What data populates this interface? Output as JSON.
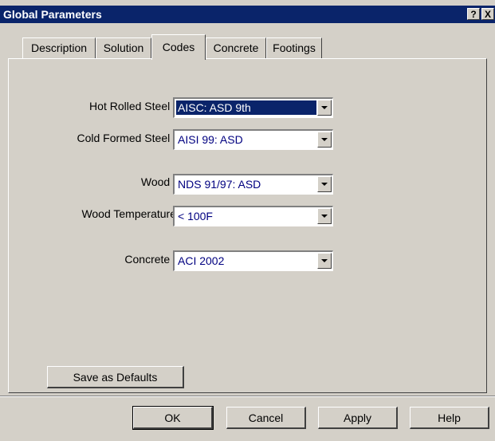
{
  "window": {
    "title": "Global Parameters",
    "help_button": "?",
    "close_button": "X"
  },
  "tabs": [
    {
      "label": "Description"
    },
    {
      "label": "Solution"
    },
    {
      "label": "Codes",
      "active": true
    },
    {
      "label": "Concrete"
    },
    {
      "label": "Footings"
    }
  ],
  "codes": {
    "hot_rolled_steel": {
      "label": "Hot Rolled Steel :",
      "value": "AISC: ASD 9th"
    },
    "cold_formed_steel": {
      "label": "Cold Formed Steel :",
      "value": "AISI 99: ASD"
    },
    "wood": {
      "label": "Wood :",
      "value": "NDS 91/97: ASD"
    },
    "wood_temperature": {
      "label": "Wood Temperature",
      "value": "< 100F"
    },
    "concrete": {
      "label": "Concrete :",
      "value": "ACI 2002"
    }
  },
  "buttons": {
    "save_defaults": "Save as Defaults",
    "ok": "OK",
    "cancel": "Cancel",
    "apply": "Apply",
    "help": "Help"
  },
  "colors": {
    "titlebar": "#0a246a",
    "face": "#d4d0c8",
    "selection": "#0a246a",
    "combo_text": "#000080"
  }
}
